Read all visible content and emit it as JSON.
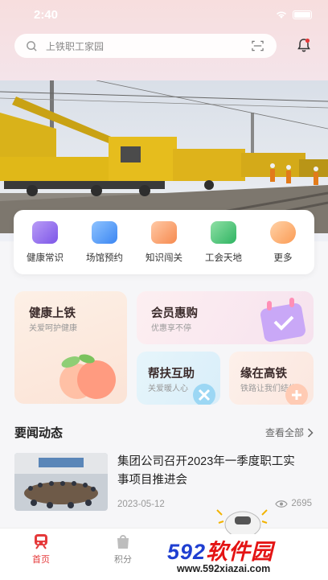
{
  "status_bar": {
    "time": "2:40"
  },
  "search": {
    "placeholder": "上铁职工家园"
  },
  "quick_entries": [
    {
      "label": "健康常识",
      "icon": "health-knowledge-icon"
    },
    {
      "label": "场馆预约",
      "icon": "venue-booking-icon"
    },
    {
      "label": "知识闯关",
      "icon": "quiz-icon"
    },
    {
      "label": "工会天地",
      "icon": "union-icon"
    },
    {
      "label": "更多",
      "icon": "more-icon"
    }
  ],
  "feature_tiles": [
    {
      "title": "健康上铁",
      "subtitle": "关爱呵护健康"
    },
    {
      "title": "会员惠购",
      "subtitle": "优惠享不停"
    },
    {
      "title": "帮扶互助",
      "subtitle": "关爱暖人心"
    },
    {
      "title": "缘在高铁",
      "subtitle": "铁路让我们结缘"
    }
  ],
  "news_section": {
    "title": "要闻动态",
    "see_all": "查看全部"
  },
  "news": [
    {
      "title": "集团公司召开2023年一季度职工实事项目推进会",
      "date": "2023-05-12",
      "views": "2695"
    }
  ],
  "tabbar": [
    {
      "label": "首页",
      "active": true
    },
    {
      "label": "积分",
      "active": false
    }
  ],
  "watermark": {
    "brand_a": "592",
    "brand_b": "软件园",
    "url": "www.592xiazai.com"
  },
  "colors": {
    "accent": "#e5393a",
    "brand_blue": "#1f3fd1"
  }
}
